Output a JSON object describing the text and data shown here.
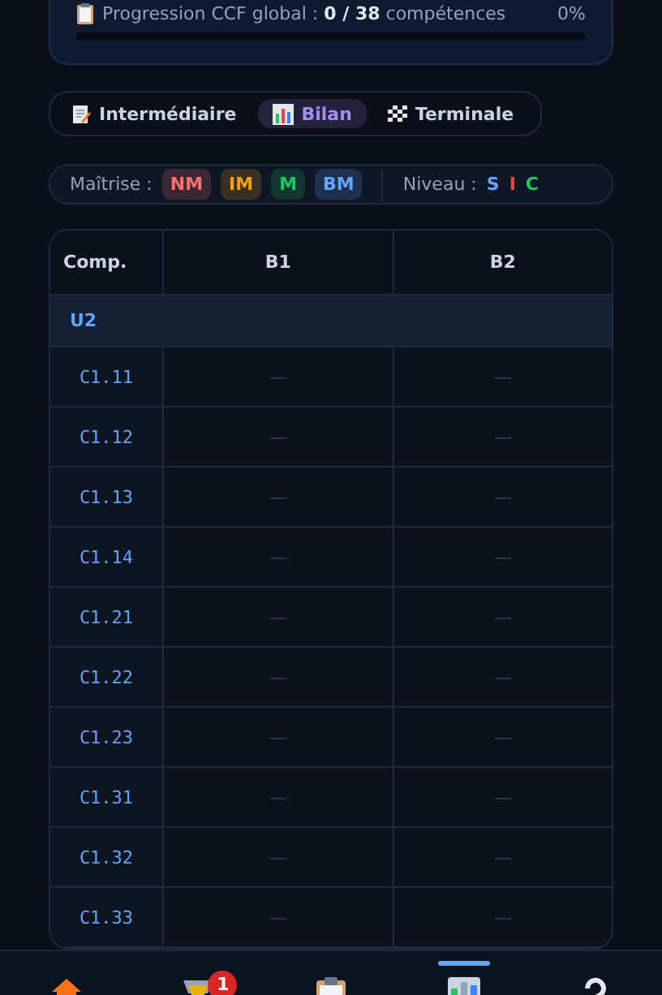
{
  "progress": {
    "label": "Progression CCF global : **0 / 38** compétences",
    "percent": "0%",
    "level": 0
  },
  "tabs": [
    {
      "label": "Intermédiaire",
      "selected": false
    },
    {
      "label": "Bilan",
      "selected": true
    },
    {
      "label": "Terminale",
      "selected": false
    }
  ],
  "legend": {
    "mastery_label": "Maîtrise :",
    "mastery": [
      {
        "label": "NM"
      },
      {
        "label": "IM"
      },
      {
        "label": "M"
      },
      {
        "label": "BM"
      }
    ],
    "level_label": "Niveau :",
    "levels": [
      {
        "label": "S",
        "color": "#60a5fa"
      },
      {
        "label": "I",
        "color": "#ef4444"
      },
      {
        "label": "C",
        "color": "#22c55e"
      }
    ]
  },
  "table": {
    "columns": [
      "Comp.",
      "B1",
      "B2"
    ],
    "group": "U2",
    "rows": [
      {
        "comp": "C1.11",
        "b1": "—",
        "b2": "—"
      },
      {
        "comp": "C1.12",
        "b1": "—",
        "b2": "—"
      },
      {
        "comp": "C1.13",
        "b1": "—",
        "b2": "—"
      },
      {
        "comp": "C1.14",
        "b1": "—",
        "b2": "—"
      },
      {
        "comp": "C1.21",
        "b1": "—",
        "b2": "—"
      },
      {
        "comp": "C1.22",
        "b1": "—",
        "b2": "—"
      },
      {
        "comp": "C1.23",
        "b1": "—",
        "b2": "—"
      },
      {
        "comp": "C1.31",
        "b1": "—",
        "b2": "—"
      },
      {
        "comp": "C1.32",
        "b1": "—",
        "b2": "—"
      },
      {
        "comp": "C1.33",
        "b1": "—",
        "b2": "—"
      }
    ]
  },
  "nav": [
    {
      "selected": false
    },
    {
      "selected": false,
      "badge": "1"
    },
    {
      "selected": false
    },
    {
      "selected": true
    },
    {
      "selected": false
    }
  ]
}
